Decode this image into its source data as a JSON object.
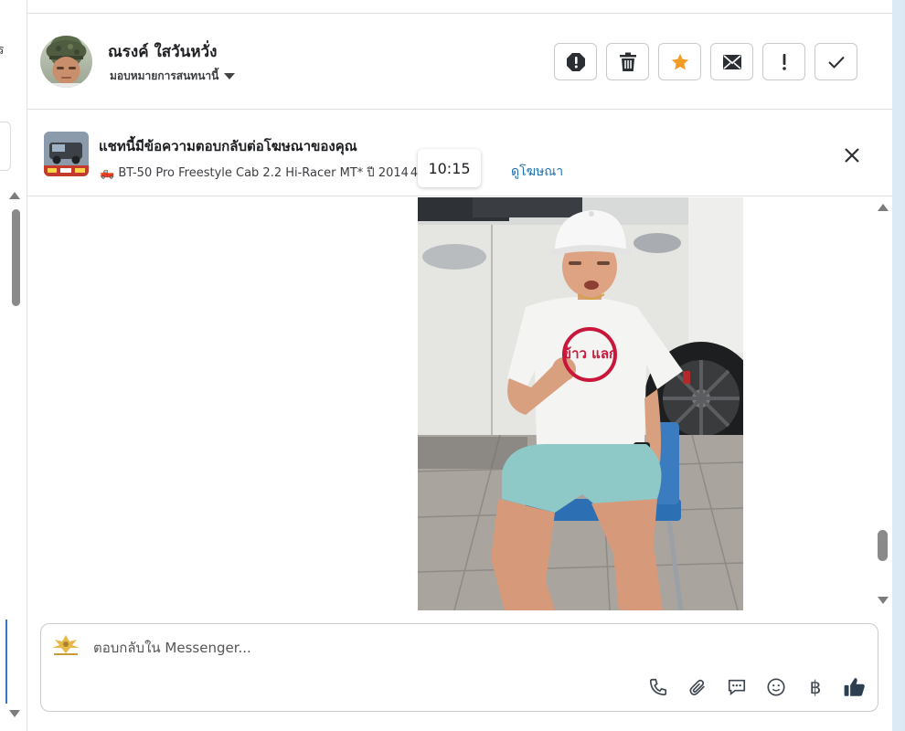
{
  "left_panel": {
    "cut_text": "ร"
  },
  "header": {
    "user_name": "ณรงค์ ใสวันหวั่ง",
    "assign_label": "มอบหมายการสนทนานี้",
    "actions": [
      {
        "icon": "alert-circle-icon"
      },
      {
        "icon": "trash-icon"
      },
      {
        "icon": "star-icon"
      },
      {
        "icon": "envelope-icon"
      },
      {
        "icon": "exclamation-icon"
      },
      {
        "icon": "check-icon"
      }
    ],
    "star_color": "#f39c25"
  },
  "ad": {
    "title": "แชทนี้มีข้อความตอบกลับต่อโฆษณาของคุณ",
    "subtitle": "🛻 BT-50 Pro Freestyle Cab 2.2 Hi-Racer MT* ปี 2014",
    "subtitle_hidden_suffix": "4 …",
    "link": "ดูโฆษณา",
    "link_color": "#1d6fb0"
  },
  "tooltip": {
    "time": "10:15"
  },
  "photo_caption": "ข้าว แลก",
  "composer": {
    "placeholder": "ตอบกลับใน Messenger...",
    "page_logo_text": "ข้าว แลก",
    "tools": [
      "phone-icon",
      "paperclip-icon",
      "chat-bubble-icon",
      "smiley-icon",
      "baht-icon",
      "thumbs-up-icon"
    ],
    "baht_symbol": "฿"
  }
}
